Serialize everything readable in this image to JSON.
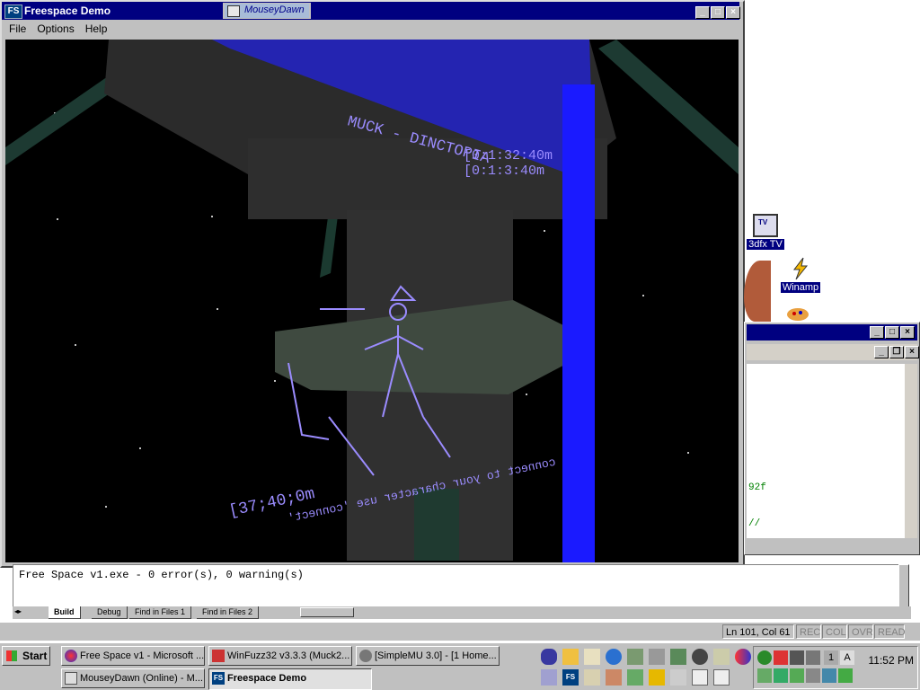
{
  "main_window": {
    "title": "Freespace Demo",
    "logo": "FS",
    "menu": [
      "File",
      "Options",
      "Help"
    ],
    "buttons": [
      "minimize",
      "maximize",
      "close"
    ],
    "chip_label": "MouseyDawn"
  },
  "viewport": {
    "text_lines": [
      "[0:1:32:40m",
      "[0:1:3:40m",
      "MUCK - DINCTOPIA",
      "[37;40;0m",
      "connect to your character use 'connect'"
    ]
  },
  "output": {
    "line": "Free Space v1.exe - 0 error(s), 0 warning(s)",
    "tabs": [
      "Build",
      "Debug",
      "Find in Files 1",
      "Find in Files 2"
    ]
  },
  "status": {
    "position": "Ln 101, Col 61",
    "indicators": [
      "REC",
      "COL",
      "OVR",
      "READ"
    ]
  },
  "right_window": {
    "code_snip": "92f",
    "code_snip2": "//"
  },
  "desktop_icons": [
    {
      "label": "3dfx TV"
    },
    {
      "label": "Winamp"
    }
  ],
  "taskbar": {
    "start_label": "Start",
    "tasks": [
      {
        "label": "Free Space v1 - Microsoft ..."
      },
      {
        "label": "WinFuzz32 v3.3.3 (Muck2..."
      },
      {
        "label": "[SimpleMU 3.0] - [1 Home..."
      },
      {
        "label": "MouseyDawn (Online) - M..."
      },
      {
        "label": "Freespace Demo"
      }
    ],
    "clock": "11:52 PM",
    "tray_num": "1",
    "tray_letter": "A"
  },
  "colors": {
    "title_bar": "#000080",
    "chrome": "#c0c0c0",
    "viewport_bg": "#000000",
    "beam_blue": "#1a1aff",
    "ascii_violet": "#9b8cff"
  }
}
